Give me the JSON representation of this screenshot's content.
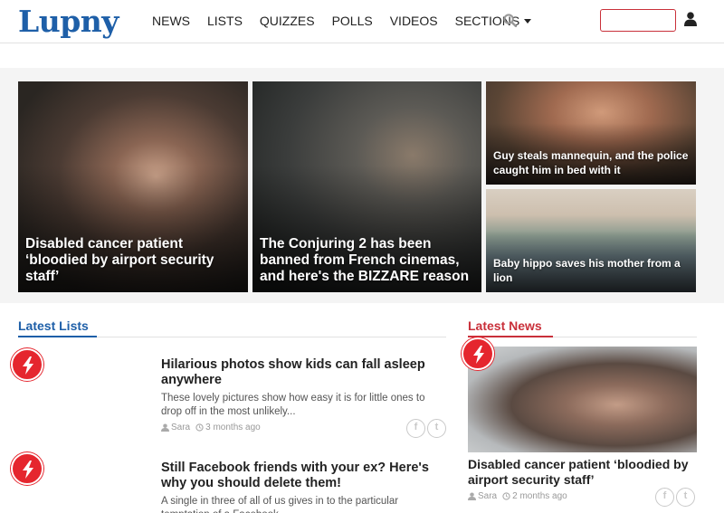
{
  "header": {
    "logo": "Lupny",
    "nav": [
      "NEWS",
      "LISTS",
      "QUIZZES",
      "POLLS",
      "VIDEOS",
      "SECTIONS"
    ],
    "search_icon": "search-icon",
    "search_placeholder": "",
    "user_icon": "user-icon"
  },
  "hero": [
    {
      "caption": "Disabled cancer patient ‘bloodied by airport security staff’"
    },
    {
      "caption": "The Conjuring 2 has been banned from French cinemas, and here's the BIZZARE reason"
    },
    {
      "caption": "Guy steals mannequin, and the police caught him in bed with it"
    },
    {
      "caption": "Baby hippo saves his mother from a lion"
    }
  ],
  "latest_lists": {
    "heading": "Latest Lists",
    "items": [
      {
        "title": "Hilarious photos show kids can fall asleep anywhere",
        "excerpt": "These lovely pictures show how easy it is for little ones to drop off in the most unlikely...",
        "author": "Sara",
        "time": "3 months ago"
      },
      {
        "title": "Still Facebook friends with your ex? Here's why you should delete them!",
        "excerpt": "A single in three of all of us gives in to the particular temptation of a Facebook ...",
        "author": "",
        "time": ""
      }
    ]
  },
  "latest_news": {
    "heading": "Latest News",
    "items": [
      {
        "title": "Disabled cancer patient ‘bloodied by airport security staff’",
        "author": "Sara",
        "time": "2 months ago"
      }
    ]
  },
  "colors": {
    "brand_blue": "#1e5fa8",
    "accent_red": "#c9303a",
    "badge_red": "#e5262e"
  }
}
